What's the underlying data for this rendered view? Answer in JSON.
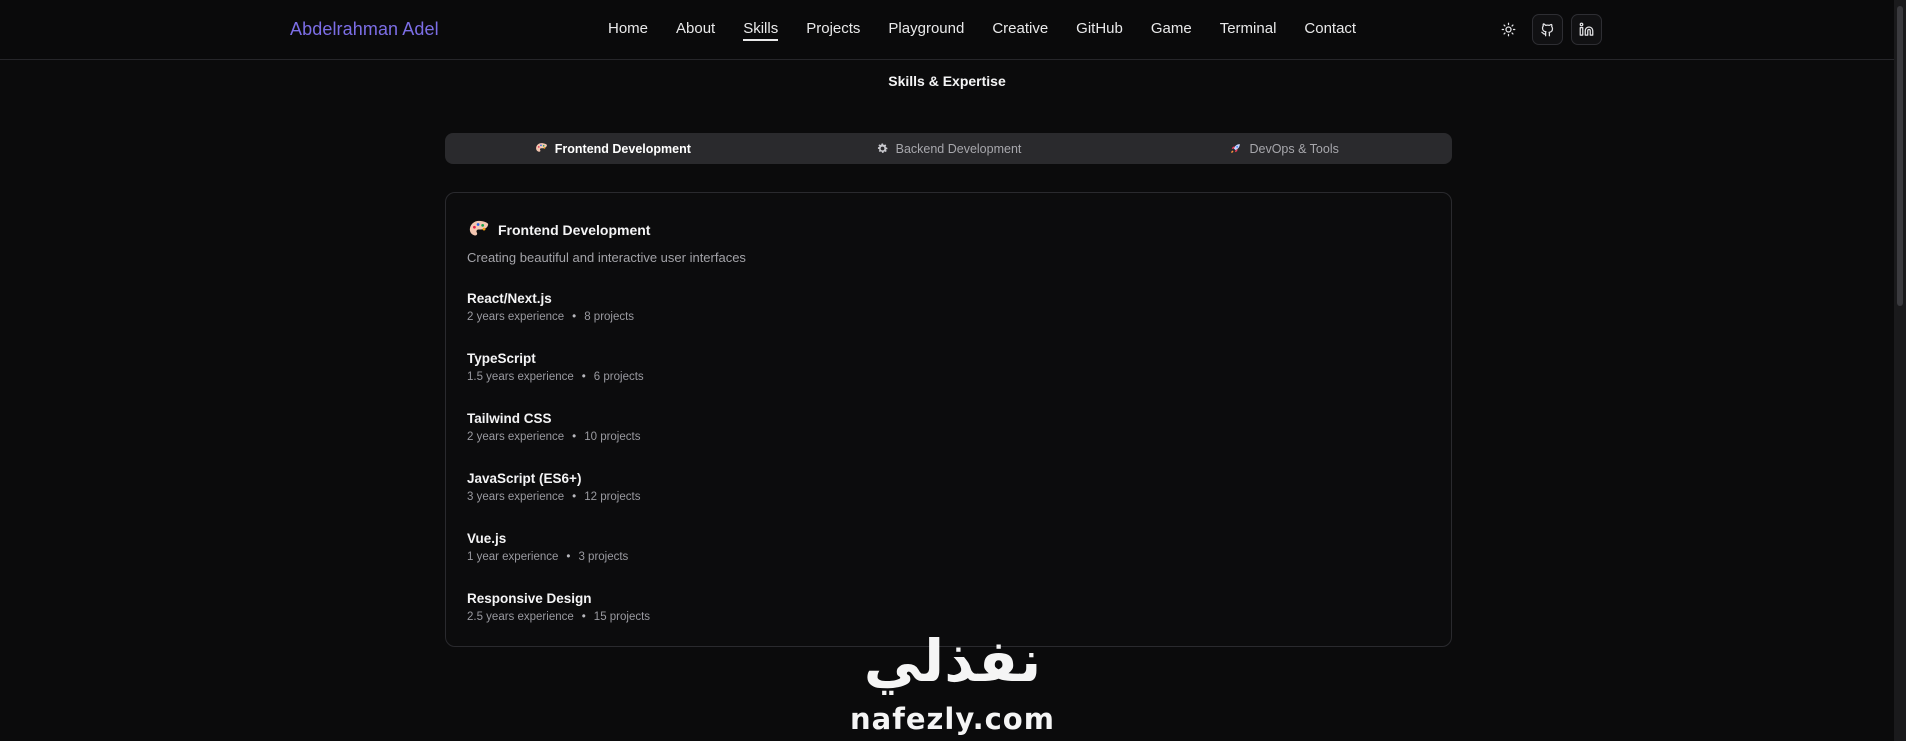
{
  "header": {
    "brand": "Abdelrahman Adel",
    "nav": [
      "Home",
      "About",
      "Skills",
      "Projects",
      "Playground",
      "Creative",
      "GitHub",
      "Game",
      "Terminal",
      "Contact"
    ],
    "active_nav": "Skills",
    "actions": [
      "sun-icon",
      "github-icon",
      "linkedin-icon"
    ]
  },
  "section": {
    "title": "Skills & Expertise",
    "tabs": [
      {
        "label": "Frontend Development",
        "icon": "palette-icon",
        "active": true
      },
      {
        "label": "Backend Development",
        "icon": "gear-icon",
        "active": false
      },
      {
        "label": "DevOps & Tools",
        "icon": "rocket-icon",
        "active": false
      }
    ]
  },
  "card": {
    "icon": "palette-icon",
    "title": "Frontend Development",
    "description": "Creating beautiful and interactive user interfaces",
    "skills": [
      {
        "name": "React/Next.js",
        "experience": "2 years experience",
        "projects": "8 projects"
      },
      {
        "name": "TypeScript",
        "experience": "1.5 years experience",
        "projects": "6 projects"
      },
      {
        "name": "Tailwind CSS",
        "experience": "2 years experience",
        "projects": "10 projects"
      },
      {
        "name": "JavaScript (ES6+)",
        "experience": "3 years experience",
        "projects": "12 projects"
      },
      {
        "name": "Vue.js",
        "experience": "1 year experience",
        "projects": "3 projects"
      },
      {
        "name": "Responsive Design",
        "experience": "2.5 years experience",
        "projects": "15 projects"
      }
    ],
    "separator": "•"
  },
  "watermark": {
    "arabic": "نفذلي",
    "latin": "nafezly.com"
  },
  "colors": {
    "background": "#0b0b0c",
    "brand": "#7c6ee6",
    "tab_bar": "#2a2a2d",
    "card_border": "#2a2a2e"
  }
}
